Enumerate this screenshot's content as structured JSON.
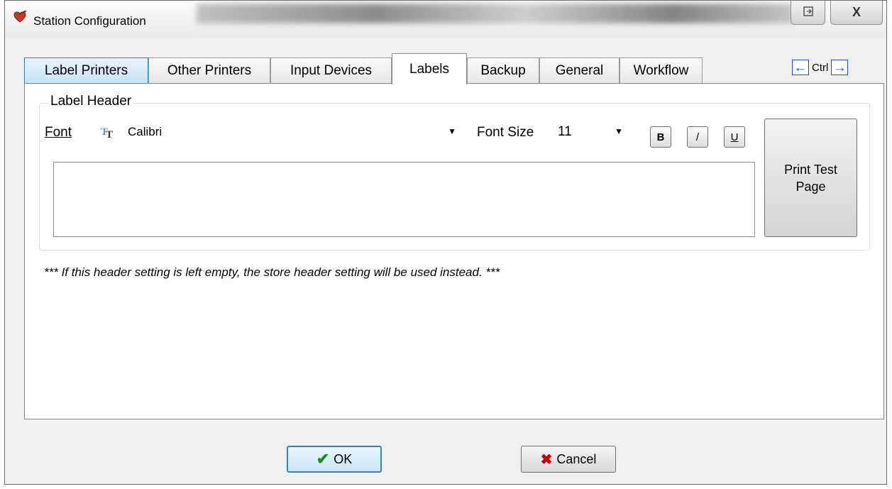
{
  "window": {
    "title": "Station Configuration",
    "icons": {
      "app": "heart-icon",
      "restore": "restore-icon",
      "close": "close-icon"
    },
    "close_glyph": "X"
  },
  "tabs": [
    {
      "label": "Label Printers"
    },
    {
      "label": "Other Printers"
    },
    {
      "label": "Input Devices"
    },
    {
      "label": "Labels",
      "active": true
    },
    {
      "label": "Backup"
    },
    {
      "label": "General"
    },
    {
      "label": "Workflow"
    }
  ],
  "tab_nav": {
    "label": "Ctrl",
    "left_icon": "arrow-left-icon",
    "right_icon": "arrow-right-icon"
  },
  "label_header": {
    "group_title": "Label Header",
    "font_label": "Font",
    "font_value": "Calibri",
    "font_icon": "truetype-font-icon",
    "font_size_label": "Font Size",
    "font_size_value": "11",
    "bold": "B",
    "italic": "/",
    "underline": "U",
    "text_value": "",
    "print_test_label": "Print Test Page"
  },
  "note": "*** If this header setting is left empty, the store header setting will be used instead. ***",
  "buttons": {
    "ok": "OK",
    "cancel": "Cancel"
  },
  "colors": {
    "accent": "#3c7fb1",
    "ok_check": "#1e8a1e",
    "cancel_x": "#c00000"
  }
}
